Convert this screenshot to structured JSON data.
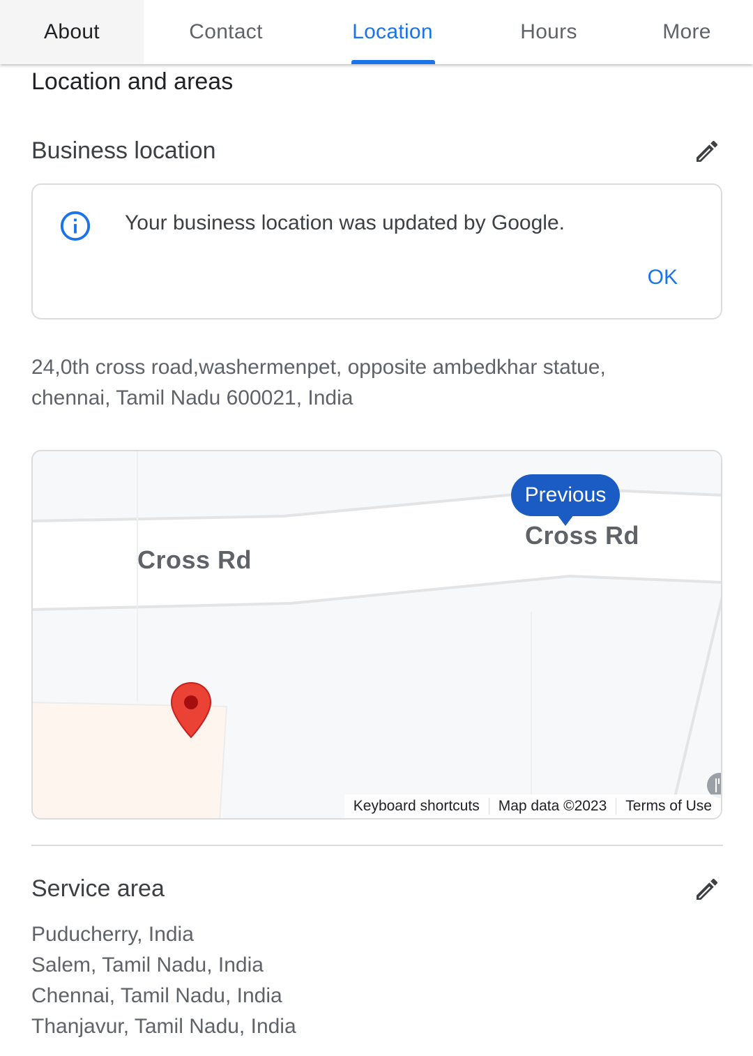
{
  "tabs": [
    {
      "label": "About"
    },
    {
      "label": "Contact"
    },
    {
      "label": "Location"
    },
    {
      "label": "Hours"
    },
    {
      "label": "More"
    }
  ],
  "active_tab": "Location",
  "section": {
    "title": "Location and areas"
  },
  "business_location": {
    "title": "Business location",
    "notice": {
      "text": "Your business location was updated by Google.",
      "action": "OK"
    },
    "address_line1": "24,0th cross road,washermenpet, opposite ambedkhar statue,",
    "address_line2": "chennai, Tamil Nadu 600021, India"
  },
  "map": {
    "road_labels": [
      "Cross Rd",
      "Cross Rd"
    ],
    "previous_label": "Previous",
    "attribution": [
      "Keyboard shortcuts",
      "Map data ©2023",
      "Terms of Use"
    ]
  },
  "service_area": {
    "title": "Service area",
    "areas": [
      "Puducherry, India",
      "Salem, Tamil Nadu, India",
      "Chennai, Tamil Nadu, India",
      "Thanjavur, Tamil Nadu, India"
    ]
  },
  "colors": {
    "accent": "#1a73e8",
    "bubble": "#1a5bc4",
    "pin": "#ea4335"
  },
  "icons": {
    "edit": "pencil-icon",
    "info": "info-icon",
    "pin": "map-pin-icon",
    "poi": "restaurant-icon"
  }
}
